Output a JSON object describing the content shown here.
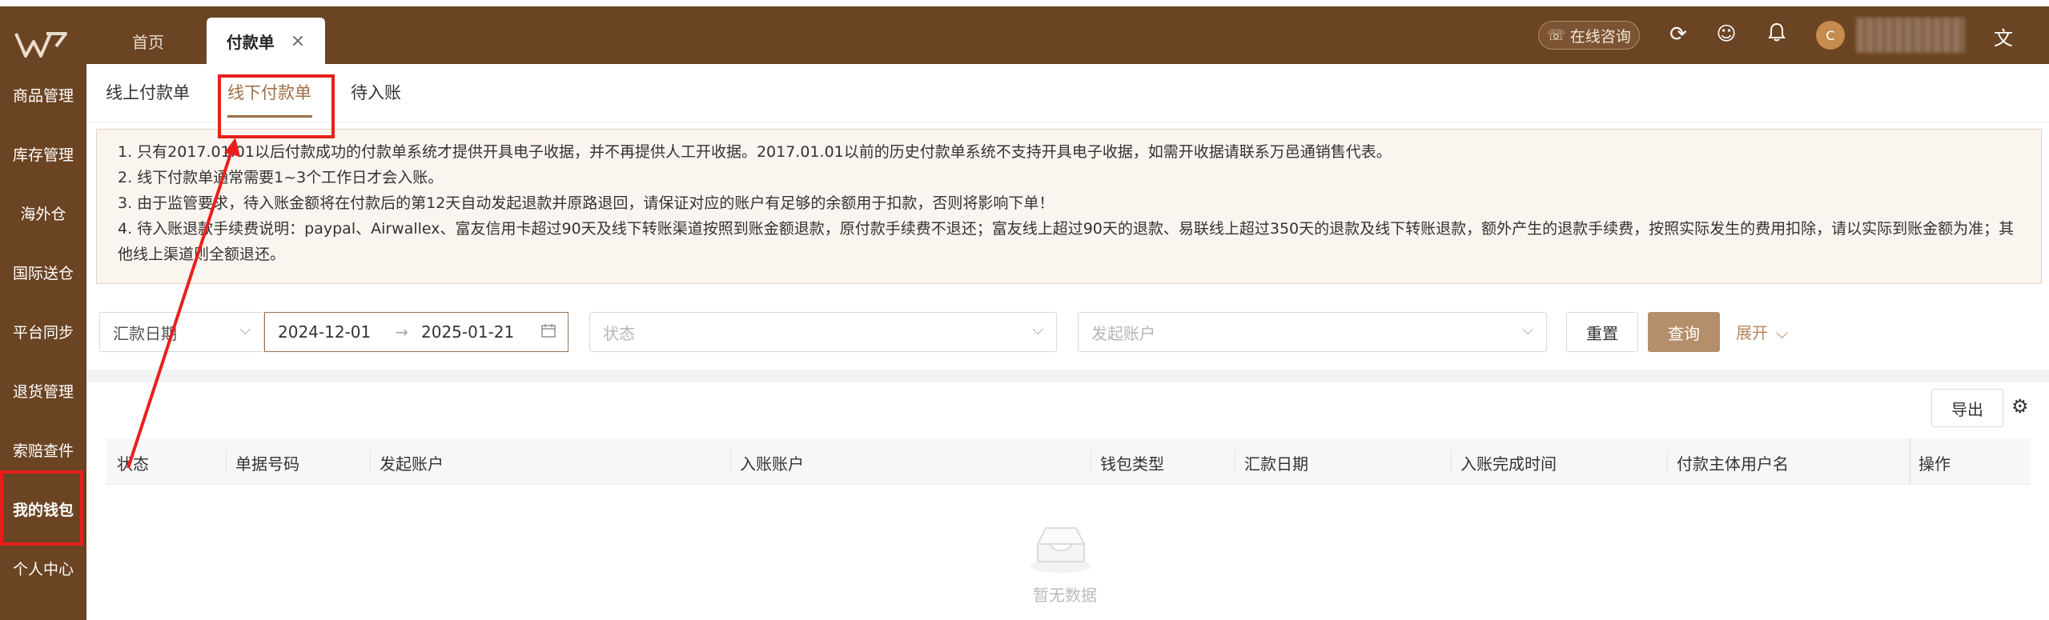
{
  "top_tabs": [
    {
      "label": "首页"
    },
    {
      "label": "付款单",
      "close": "×"
    }
  ],
  "header": {
    "consult_label": "在线咨询",
    "avatar_letter": "C",
    "icons": [
      "refresh-icon",
      "smile-icon",
      "bell-icon",
      "translate-icon"
    ]
  },
  "sidebar": {
    "items": [
      {
        "label": "商品管理"
      },
      {
        "label": "库存管理"
      },
      {
        "label": "海外仓"
      },
      {
        "label": "国际送仓"
      },
      {
        "label": "平台同步"
      },
      {
        "label": "退货管理"
      },
      {
        "label": "索赔查件"
      },
      {
        "label": "我的钱包"
      },
      {
        "label": "个人中心"
      }
    ]
  },
  "sub_tabs": [
    {
      "label": "线上付款单"
    },
    {
      "label": "线下付款单"
    },
    {
      "label": "待入账"
    }
  ],
  "notice": {
    "lines": [
      "1. 只有2017.01.01以后付款成功的付款单系统才提供开具电子收据，并不再提供人工开收据。2017.01.01以前的历史付款单系统不支持开具电子收据，如需开收据请联系万邑通销售代表。",
      "2. 线下付款单通常需要1~3个工作日才会入账。",
      "3. 由于监管要求，待入账金额将在付款后的第12天自动发起退款并原路退回，请保证对应的账户有足够的余额用于扣款，否则将影响下单！",
      "4. 待入账退款手续费说明：paypal、Airwallex、富友信用卡超过90天及线下转账渠道按照到账金额退款，原付款手续费不退还；富友线上超过90天的退款、易联线上超过350天的退款及线下转账退款，额外产生的退款手续费，按照实际发生的费用扣除，请以实际到账金额为准；其他线上渠道则全额退还。"
    ]
  },
  "filters": {
    "date_type": "汇款日期",
    "date_start": "2024-12-01",
    "date_sep": "→",
    "date_end": "2025-01-21",
    "status_placeholder": "状态",
    "account_placeholder": "发起账户",
    "reset_label": "重置",
    "query_label": "查询",
    "expand_label": "展开"
  },
  "table": {
    "export_label": "导出",
    "columns": [
      "状态",
      "单据号码",
      "发起账户",
      "入账账户",
      "钱包类型",
      "汇款日期",
      "入账完成时间",
      "付款主体用户名",
      "操作"
    ],
    "rows": [],
    "empty_text": "暂无数据"
  },
  "colors": {
    "brand_brown": "#6b4423",
    "accent": "#a06f45",
    "query_button": "#b58e6b",
    "annotation_red": "#e8201c"
  }
}
